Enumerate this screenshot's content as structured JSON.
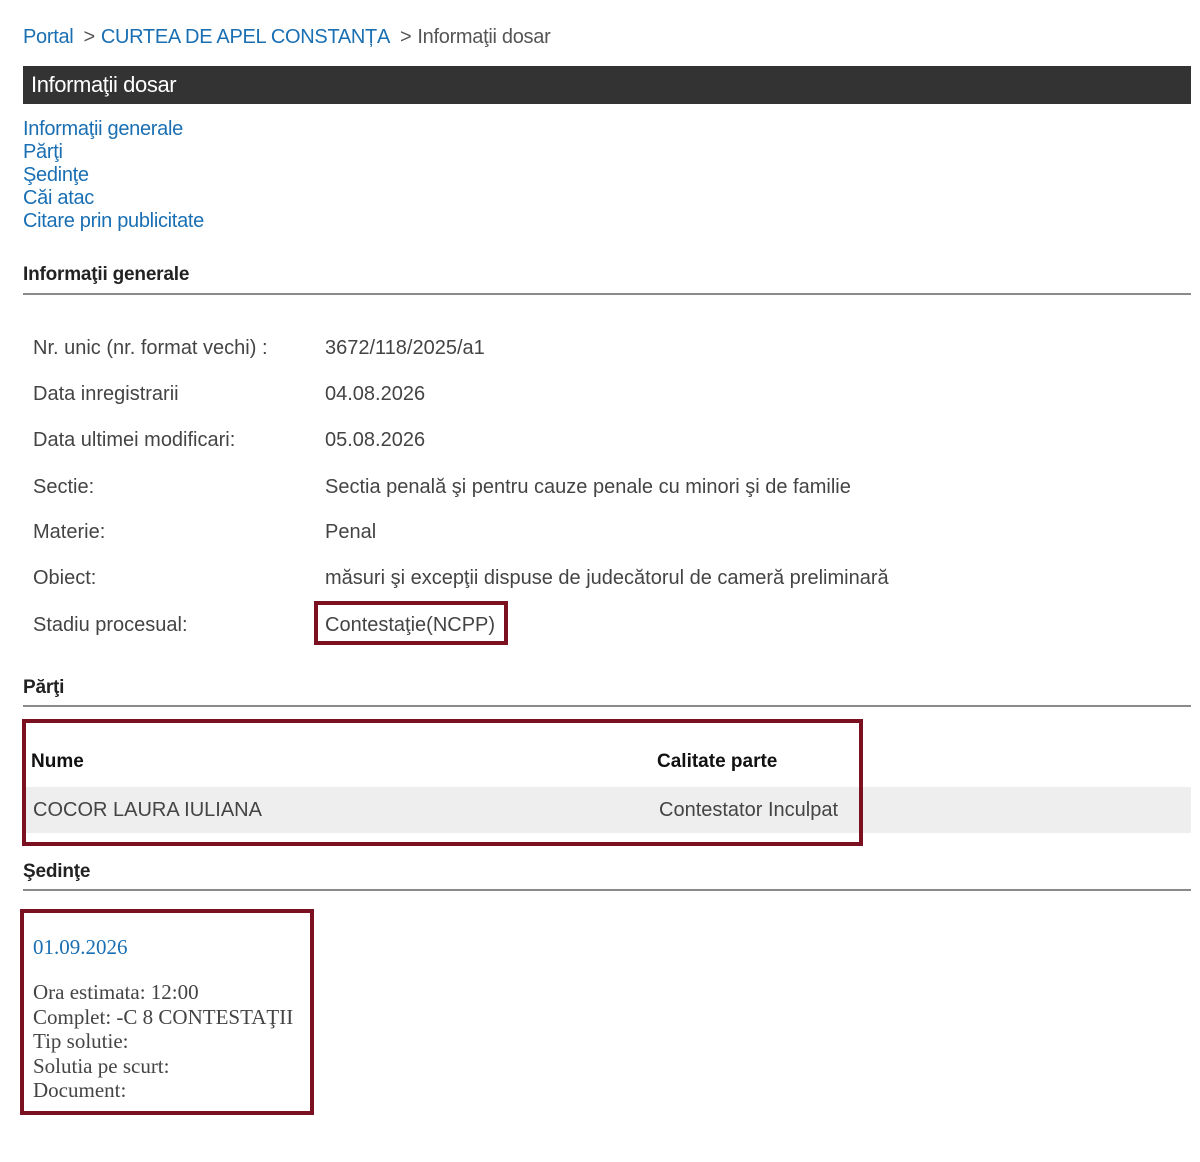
{
  "breadcrumb": {
    "portal": "Portal",
    "court": "CURTEA DE APEL CONSTANȚA",
    "current": "Informaţii dosar",
    "separator": ">"
  },
  "title": "Informaţii dosar",
  "nav": [
    "Informaţii generale",
    "Părţi",
    "Şedinţe",
    "Căi atac",
    "Citare prin publicitate"
  ],
  "general": {
    "heading": "Informaţii generale",
    "rows": [
      {
        "label": "Nr. unic (nr. format vechi) :",
        "value": "3672/118/2025/a1"
      },
      {
        "label": "Data inregistrarii",
        "value": "04.08.2026"
      },
      {
        "label": "Data ultimei modificari:",
        "value": "05.08.2026"
      },
      {
        "label": "Sectie:",
        "value": "Sectia penală şi pentru cauze penale cu minori şi de familie"
      },
      {
        "label": "Materie:",
        "value": "Penal"
      },
      {
        "label": "Obiect:",
        "value": "măsuri şi excepţii dispuse de judecătorul de cameră preliminară"
      },
      {
        "label": "Stadiu procesual:",
        "value": "Contestaţie(NCPP)"
      }
    ]
  },
  "parties": {
    "heading": "Părţi",
    "columns": [
      "Nume",
      "Calitate parte"
    ],
    "rows": [
      {
        "name": "COCOR LAURA IULIANA",
        "role": "Contestator Inculpat"
      }
    ]
  },
  "hearings": {
    "heading": "Şedinţe",
    "items": [
      {
        "date": "01.09.2026",
        "lines": [
          "Ora estimata: 12:00",
          "Complet: -C 8 CONTESTAŢII",
          "Tip solutie:",
          "Solutia pe scurt:",
          "Document:"
        ]
      }
    ]
  },
  "colors": {
    "link": "#1a6fb3",
    "titlebar": "#333333",
    "highlight_border": "#7b1020",
    "row_bg": "#eeeeee"
  }
}
